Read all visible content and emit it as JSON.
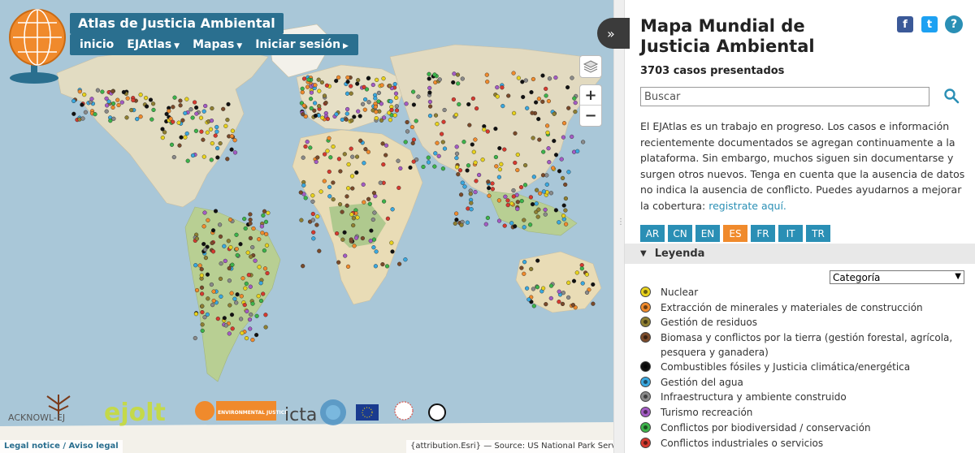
{
  "header": {
    "brand": "Atlas de Justicia Ambiental",
    "nav": [
      {
        "label": "inicio",
        "dropdown": false
      },
      {
        "label": "EJAtlas",
        "dropdown": true
      },
      {
        "label": "Mapas",
        "dropdown": true
      },
      {
        "label": "Iniciar sesión",
        "dropdown": false,
        "arrow": true
      }
    ]
  },
  "map": {
    "zoom_in": "+",
    "zoom_out": "−",
    "collapse_icon": "»",
    "partners": [
      "ACKNOWL-EJ",
      "ejolt",
      "ENVIRONMENTAL JUSTICE",
      "icta"
    ],
    "legal": "Legal notice / Aviso legal",
    "attribution": "{attribution.Esri} — Source: US National Park Service",
    "colors": {
      "ocean": "#a9c7d8",
      "land": "#ede3cc",
      "forest": "#a8c78a"
    }
  },
  "panel": {
    "title": "Mapa Mundial de Justicia Ambiental",
    "social": {
      "facebook": "f",
      "twitter": "t",
      "help": "?"
    },
    "cases": "3703 casos presentados",
    "search": {
      "placeholder": "Buscar",
      "value": ""
    },
    "intro": "El EJAtlas es un trabajo en progreso. Los casos e información recientemente documentados se agregan continuamente a la plataforma. Sin embargo, muchos siguen sin documentarse y surgen otros nuevos. Tenga en cuenta que la ausencia de datos no indica la ausencia de conflicto. Puedes ayudarnos a mejorar la cobertura: ",
    "intro_link": "registrate aquí.",
    "languages": [
      {
        "code": "AR",
        "active": false
      },
      {
        "code": "CN",
        "active": false
      },
      {
        "code": "EN",
        "active": false
      },
      {
        "code": "ES",
        "active": true
      },
      {
        "code": "FR",
        "active": false
      },
      {
        "code": "IT",
        "active": false
      },
      {
        "code": "TR",
        "active": false
      }
    ],
    "legend_title": "Leyenda",
    "category_select": "Categoría",
    "legend": [
      {
        "label": "Nuclear",
        "color": "#e8d21d"
      },
      {
        "label": "Extracción de minerales y materiales de construcción",
        "color": "#f08a2c"
      },
      {
        "label": "Gestión de residuos",
        "color": "#8f7f32"
      },
      {
        "label": "Biomasa y conflictos por la tierra (gestión forestal, agrícola, pesquera y ganadera)",
        "color": "#7a4a2a"
      },
      {
        "label": "Combustibles fósiles y Justicia climática/energética",
        "color": "#111111"
      },
      {
        "label": "Gestión del agua",
        "color": "#3aa8e0"
      },
      {
        "label": "Infraestructura y ambiente construido",
        "color": "#8a8a8a"
      },
      {
        "label": "Turismo recreación",
        "color": "#a45bc4"
      },
      {
        "label": "Conflictos por biodiversidad / conservación",
        "color": "#3cb34a"
      },
      {
        "label": "Conflictos industriales o servicios",
        "color": "#d63a2f"
      }
    ]
  }
}
